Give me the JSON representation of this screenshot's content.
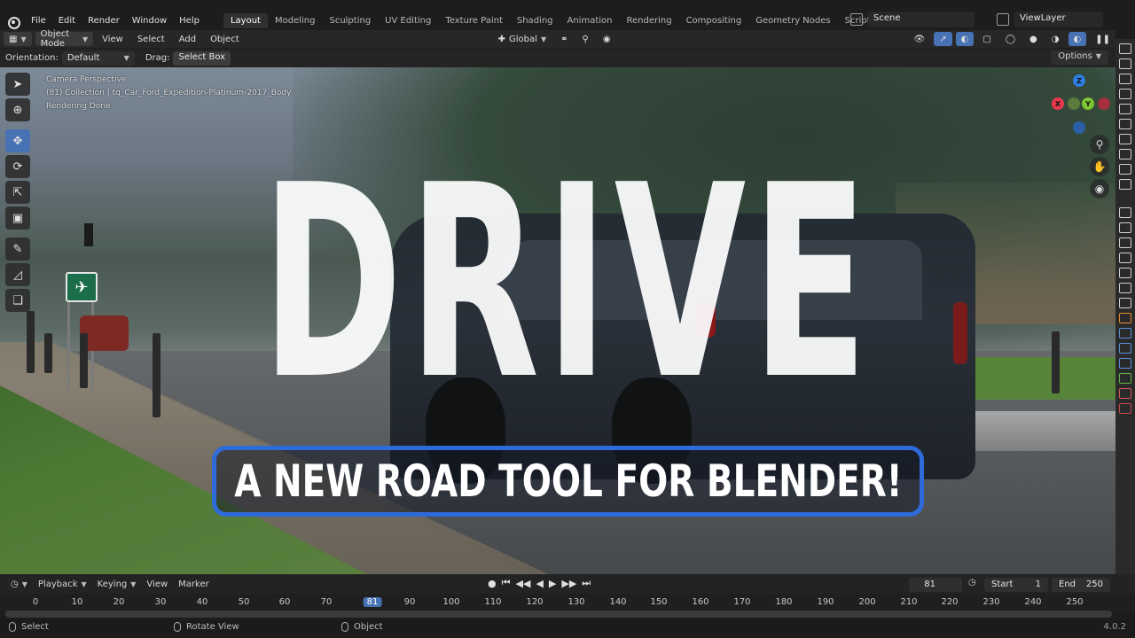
{
  "menu": {
    "items": [
      "File",
      "Edit",
      "Render",
      "Window",
      "Help"
    ],
    "workspaces": [
      "Layout",
      "Modeling",
      "Sculpting",
      "UV Editing",
      "Texture Paint",
      "Shading",
      "Animation",
      "Rendering",
      "Compositing",
      "Geometry Nodes",
      "Scripting"
    ],
    "active_workspace": "Layout",
    "add": "+",
    "scene": "Scene",
    "view_layer": "ViewLayer"
  },
  "viewport_header": {
    "mode": "Object Mode",
    "menus": [
      "View",
      "Select",
      "Add",
      "Object"
    ],
    "transform_orientation": "Global"
  },
  "tool_settings": {
    "orientation_label": "Orientation:",
    "orientation_value": "Default",
    "drag_label": "Drag:",
    "drag_value": "Select Box",
    "options": "Options"
  },
  "overlay": {
    "line1": "Camera Perspective",
    "line2": "(81) Collection | tq_Car_Ford_Expedition-Platinum-2017_Body",
    "line3": "Rendering Done"
  },
  "thumbnail": {
    "title": "DRIVE",
    "subtitle": "A NEW ROAD TOOL FOR BLENDER!"
  },
  "gizmo": {
    "z": "Z",
    "y": "Y",
    "x": "X"
  },
  "timeline": {
    "menus": [
      "Playback",
      "Keying",
      "View",
      "Marker"
    ],
    "current_frame": "81",
    "start_label": "Start",
    "start_value": "1",
    "end_label": "End",
    "end_value": "250",
    "ticks": [
      "0",
      "10",
      "20",
      "30",
      "40",
      "50",
      "60",
      "70",
      "81",
      "90",
      "100",
      "110",
      "120",
      "130",
      "140",
      "150",
      "160",
      "170",
      "180",
      "190",
      "200",
      "210",
      "220",
      "230",
      "240",
      "250"
    ]
  },
  "status": {
    "select": "Select",
    "rotate": "Rotate View",
    "object": "Object",
    "version": "4.0.2"
  },
  "colors": {
    "accent": "#4772b3",
    "title_border": "#2f6bd8"
  }
}
